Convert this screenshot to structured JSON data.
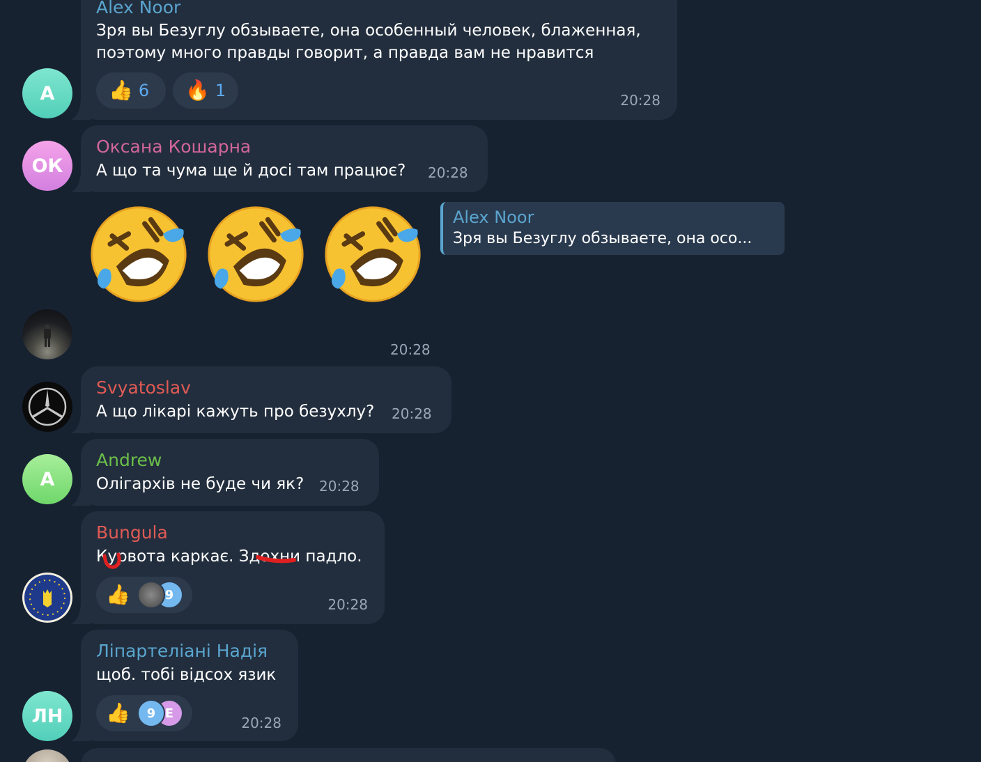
{
  "messages": [
    {
      "sender": "Alex Noor",
      "text_line1": "Зря вы Безуглу обзываете, она особенный человек, блаженная,",
      "text_line2": "поэтому много правды говорит, а правда вам не нравится",
      "time": "20:28",
      "avatar_initials": "A",
      "reactions": [
        {
          "emoji": "👍",
          "count": "6"
        },
        {
          "emoji": "🔥",
          "count": "1"
        }
      ]
    },
    {
      "sender": "Оксана Кошарна",
      "text": "А що та чума ще й досі там працює?",
      "time": "20:28",
      "avatar_initials": "ОК"
    },
    {
      "type": "sticker",
      "emoji": [
        "🤣",
        "🤣",
        "🤣"
      ],
      "reply_to_sender": "Alex Noor",
      "reply_preview": "Зря вы Безуглу обзываете, она осо...",
      "time": "20:28",
      "avatar_icon": "night-photo-avatar"
    },
    {
      "sender": "Svyatoslav",
      "text": "А що лікарі кажуть про безухлу?",
      "time": "20:28",
      "avatar_icon": "mercedes-logo-avatar"
    },
    {
      "sender": "Andrew",
      "text": "Олігархів не буде чи як?",
      "time": "20:28",
      "avatar_initials": "A"
    },
    {
      "sender": "Bungula",
      "text": "Курвота каркає. Здохни падло.",
      "time": "20:28",
      "avatar_icon": "ukraine-eu-emblem-avatar",
      "reaction_emoji": "👍",
      "reactor_initial": "9"
    },
    {
      "sender": "Ліпартеліані Надія",
      "text": "щоб. тобі відсох язик",
      "time": "20:28",
      "avatar_initials": "ЛН",
      "reaction_emoji": "👍",
      "reactor_initials": [
        "9",
        "E"
      ]
    }
  ],
  "colors": {
    "background": "#172231",
    "bubble": "#222e3d",
    "time": "#9aa7b6",
    "sender_alex": "#5aa5cf",
    "sender_oksana": "#d2669a",
    "sender_svyatoslav": "#e05a55",
    "sender_andrew": "#6cbf4a",
    "sender_bungula": "#e05a55",
    "sender_nadiya": "#5aa5cf",
    "reaction_count": "#5eaaf0"
  }
}
